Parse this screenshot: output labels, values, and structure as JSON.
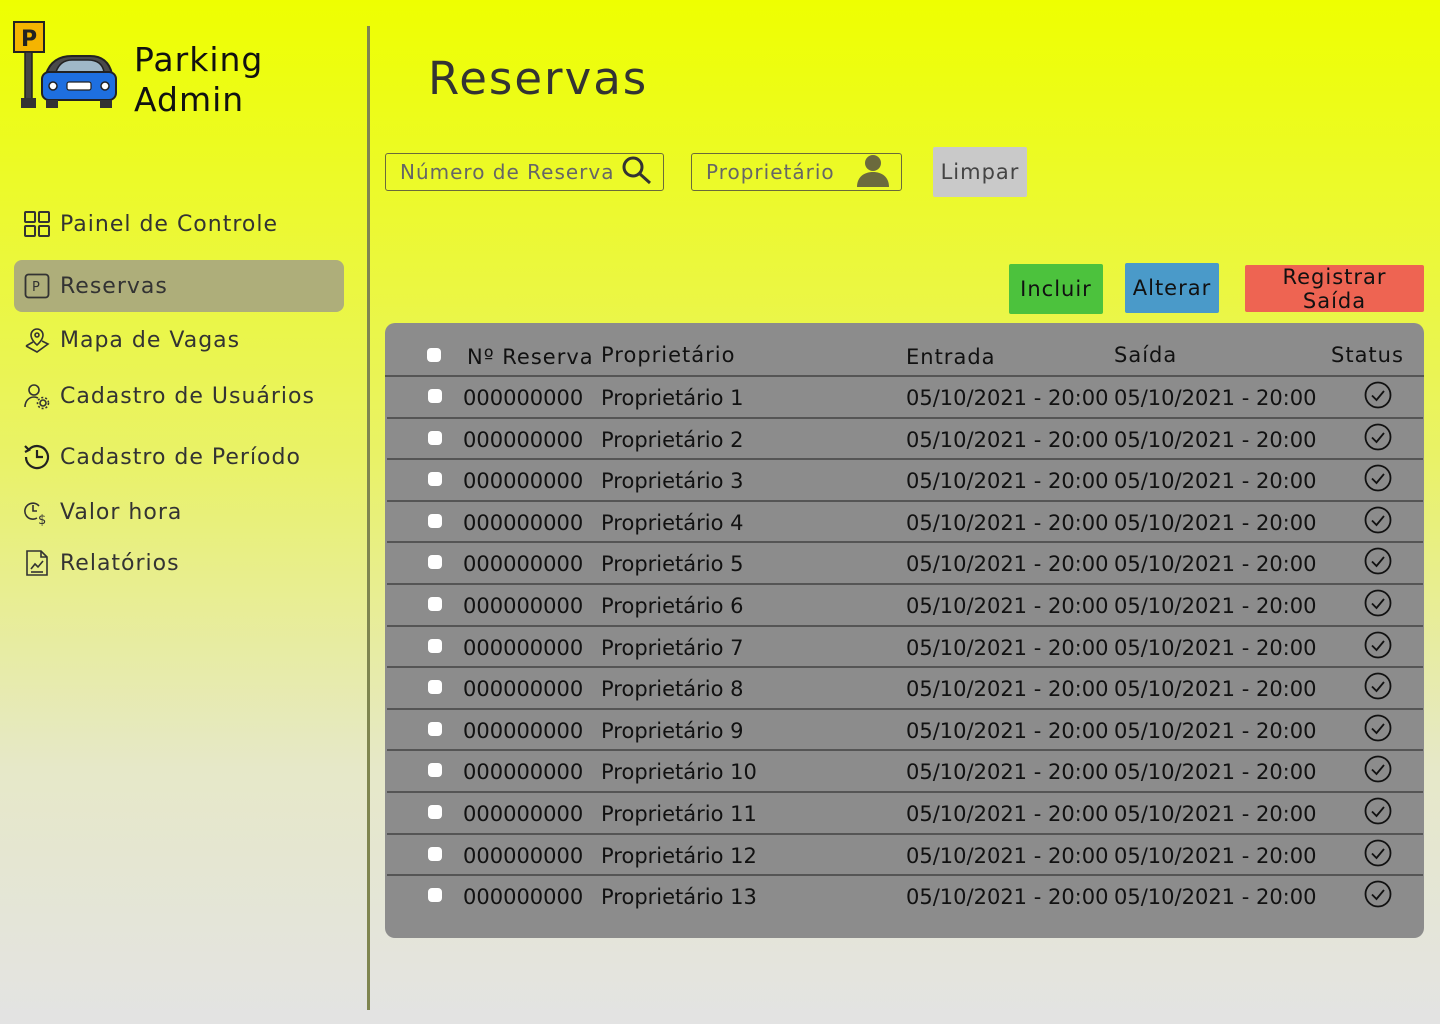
{
  "brand": {
    "line1": "Parking",
    "line2": "Admin"
  },
  "sidebar": {
    "items": [
      {
        "label": "Painel de Controle",
        "icon": "grid-icon"
      },
      {
        "label": "Reservas",
        "icon": "parking-icon",
        "active": true
      },
      {
        "label": "Mapa de Vagas",
        "icon": "map-pin-icon"
      },
      {
        "label": "Cadastro de Usuários",
        "icon": "user-settings-icon"
      },
      {
        "label": "Cadastro de Período",
        "icon": "clock-history-icon"
      },
      {
        "label": "Valor hora",
        "icon": "clock-dollar-icon"
      },
      {
        "label": "Relatórios",
        "icon": "report-icon"
      }
    ]
  },
  "page": {
    "title": "Reservas"
  },
  "filters": {
    "reservation_placeholder": "Número de Reserva",
    "owner_placeholder": "Proprietário",
    "clear_label": "Limpar"
  },
  "actions": {
    "add_label": "Incluir",
    "edit_label": "Alterar",
    "exit_label": "Registrar Saída"
  },
  "colors": {
    "add": "#4cc23d",
    "edit": "#4a9ac9",
    "exit": "#ee6452",
    "clear": "#c9c9c9",
    "table_bg": "#8c8c8c"
  },
  "table": {
    "headers": [
      "Nº Reserva",
      "Proprietário",
      "Entrada",
      "Saída",
      "Status"
    ],
    "rows": [
      {
        "number": "000000000",
        "owner": "Proprietário 1",
        "entry": "05/10/2021 - 20:00",
        "exit": "05/10/2021 - 20:00"
      },
      {
        "number": "000000000",
        "owner": "Proprietário 2",
        "entry": "05/10/2021 - 20:00",
        "exit": "05/10/2021 - 20:00"
      },
      {
        "number": "000000000",
        "owner": "Proprietário 3",
        "entry": "05/10/2021 - 20:00",
        "exit": "05/10/2021 - 20:00"
      },
      {
        "number": "000000000",
        "owner": "Proprietário 4",
        "entry": "05/10/2021 - 20:00",
        "exit": "05/10/2021 - 20:00"
      },
      {
        "number": "000000000",
        "owner": "Proprietário 5",
        "entry": "05/10/2021 - 20:00",
        "exit": "05/10/2021 - 20:00"
      },
      {
        "number": "000000000",
        "owner": "Proprietário 6",
        "entry": "05/10/2021 - 20:00",
        "exit": "05/10/2021 - 20:00"
      },
      {
        "number": "000000000",
        "owner": "Proprietário 7",
        "entry": "05/10/2021 - 20:00",
        "exit": "05/10/2021 - 20:00"
      },
      {
        "number": "000000000",
        "owner": "Proprietário 8",
        "entry": "05/10/2021 - 20:00",
        "exit": "05/10/2021 - 20:00"
      },
      {
        "number": "000000000",
        "owner": "Proprietário 9",
        "entry": "05/10/2021 - 20:00",
        "exit": "05/10/2021 - 20:00"
      },
      {
        "number": "000000000",
        "owner": "Proprietário 10",
        "entry": "05/10/2021 - 20:00",
        "exit": "05/10/2021 - 20:00"
      },
      {
        "number": "000000000",
        "owner": "Proprietário 11",
        "entry": "05/10/2021 - 20:00",
        "exit": "05/10/2021 - 20:00"
      },
      {
        "number": "000000000",
        "owner": "Proprietário 12",
        "entry": "05/10/2021 - 20:00",
        "exit": "05/10/2021 - 20:00"
      },
      {
        "number": "000000000",
        "owner": "Proprietário 13",
        "entry": "05/10/2021 - 20:00",
        "exit": "05/10/2021 - 20:00"
      }
    ]
  }
}
